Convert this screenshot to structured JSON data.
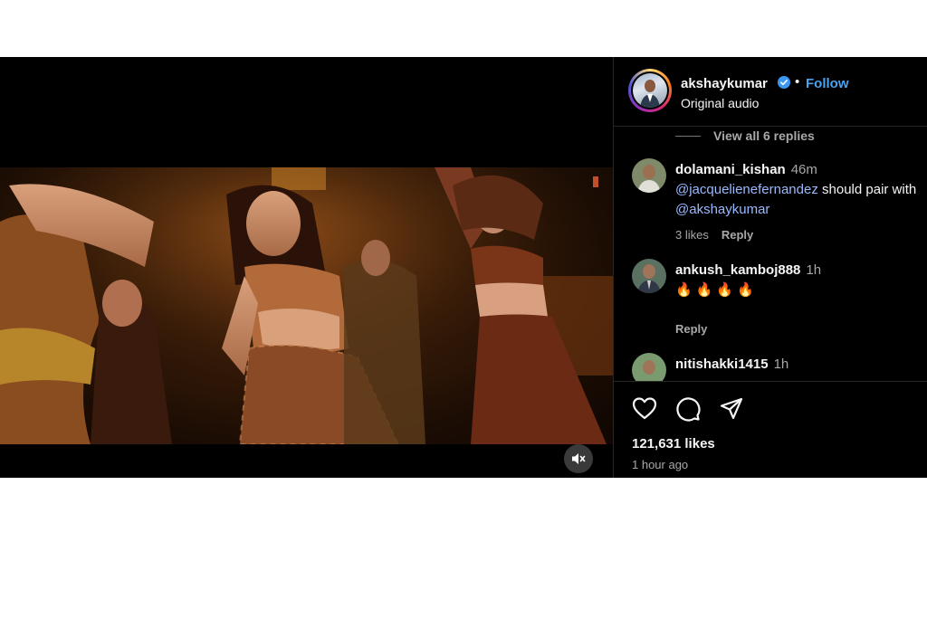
{
  "post": {
    "author": {
      "username": "akshaykumar",
      "follow_label": "Follow",
      "separator": "•",
      "audio": "Original audio"
    },
    "view_replies": "View all 6 replies",
    "comments": [
      {
        "username": "dolamani_kishan",
        "time": "46m",
        "mention1": "@jacquelienefernandez",
        "text_middle": " should pair with ",
        "mention2": "@akshaykumar",
        "likes": "3 likes",
        "reply_label": "Reply"
      },
      {
        "username": "ankush_kamboj888",
        "time": "1h",
        "emojis": "🔥🔥🔥🔥",
        "reply_label": "Reply"
      },
      {
        "username": "nitishakki1415",
        "time": "1h"
      }
    ],
    "likes_count": "121,631 likes",
    "posted_ago": "1 hour ago"
  },
  "icons": {
    "like": "heart-icon",
    "comment": "comment-icon",
    "share": "share-icon",
    "mute": "speaker-muted-icon",
    "verified": "verified-badge-icon"
  },
  "colors": {
    "link": "#4aa3f0",
    "mention": "#9ab8ff",
    "verified": "#3b97f0"
  }
}
